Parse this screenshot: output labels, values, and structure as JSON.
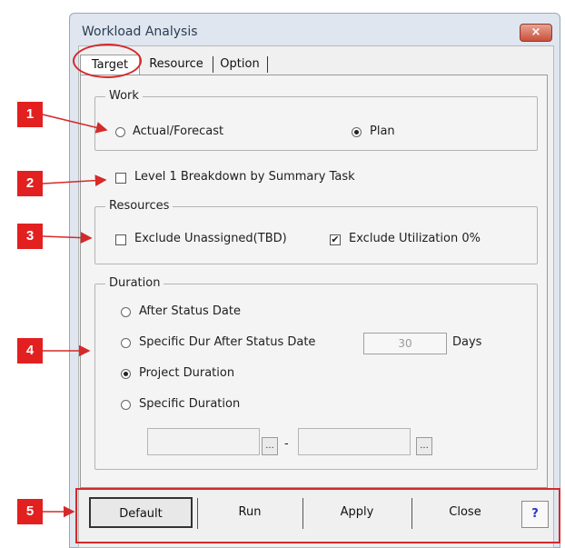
{
  "window": {
    "title": "Workload Analysis",
    "close_glyph": "×"
  },
  "tabs": [
    {
      "label": "Target"
    },
    {
      "label": "Resource"
    },
    {
      "label": "Option"
    }
  ],
  "work": {
    "legend": "Work",
    "options": [
      {
        "label": "Actual/Forecast",
        "selected": false
      },
      {
        "label": "Plan",
        "selected": true
      }
    ]
  },
  "breakdown": {
    "label": "Level 1 Breakdown by Summary Task",
    "checked": false
  },
  "resources": {
    "legend": "Resources",
    "exclude_unassigned": {
      "label": "Exclude Unassigned(TBD)",
      "checked": false
    },
    "exclude_utilization": {
      "label": "Exclude Utilization 0%",
      "checked": true
    }
  },
  "duration": {
    "legend": "Duration",
    "options": [
      {
        "label": "After Status Date",
        "selected": false
      },
      {
        "label": "Specific Dur After Status Date",
        "selected": false
      },
      {
        "label": "Project Duration",
        "selected": true
      },
      {
        "label": "Specific Duration",
        "selected": false
      }
    ],
    "days_value": "30",
    "days_unit": "Days",
    "date_button": "...",
    "range_sep": "-"
  },
  "buttons": {
    "default": "Default",
    "run": "Run",
    "apply": "Apply",
    "close": "Close",
    "help": "?"
  },
  "callouts": [
    "1",
    "2",
    "3",
    "4",
    "5"
  ],
  "colors": {
    "callout": "#e32020",
    "annotation_outline": "#d42a2a",
    "help_text": "#2236c2"
  }
}
